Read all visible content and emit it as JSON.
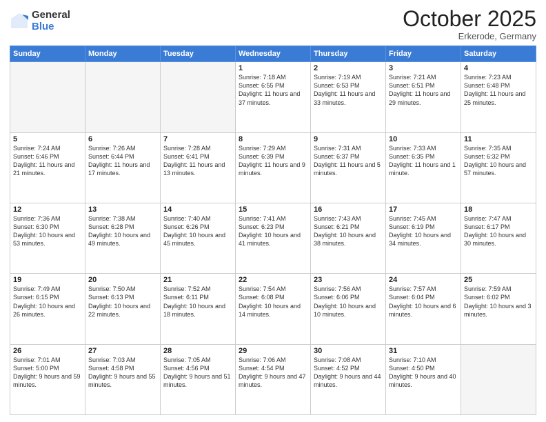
{
  "logo": {
    "general": "General",
    "blue": "Blue"
  },
  "title": "October 2025",
  "location": "Erkerode, Germany",
  "days_of_week": [
    "Sunday",
    "Monday",
    "Tuesday",
    "Wednesday",
    "Thursday",
    "Friday",
    "Saturday"
  ],
  "weeks": [
    [
      {
        "day": "",
        "info": ""
      },
      {
        "day": "",
        "info": ""
      },
      {
        "day": "",
        "info": ""
      },
      {
        "day": "1",
        "info": "Sunrise: 7:18 AM\nSunset: 6:55 PM\nDaylight: 11 hours\nand 37 minutes."
      },
      {
        "day": "2",
        "info": "Sunrise: 7:19 AM\nSunset: 6:53 PM\nDaylight: 11 hours\nand 33 minutes."
      },
      {
        "day": "3",
        "info": "Sunrise: 7:21 AM\nSunset: 6:51 PM\nDaylight: 11 hours\nand 29 minutes."
      },
      {
        "day": "4",
        "info": "Sunrise: 7:23 AM\nSunset: 6:48 PM\nDaylight: 11 hours\nand 25 minutes."
      }
    ],
    [
      {
        "day": "5",
        "info": "Sunrise: 7:24 AM\nSunset: 6:46 PM\nDaylight: 11 hours\nand 21 minutes."
      },
      {
        "day": "6",
        "info": "Sunrise: 7:26 AM\nSunset: 6:44 PM\nDaylight: 11 hours\nand 17 minutes."
      },
      {
        "day": "7",
        "info": "Sunrise: 7:28 AM\nSunset: 6:41 PM\nDaylight: 11 hours\nand 13 minutes."
      },
      {
        "day": "8",
        "info": "Sunrise: 7:29 AM\nSunset: 6:39 PM\nDaylight: 11 hours\nand 9 minutes."
      },
      {
        "day": "9",
        "info": "Sunrise: 7:31 AM\nSunset: 6:37 PM\nDaylight: 11 hours\nand 5 minutes."
      },
      {
        "day": "10",
        "info": "Sunrise: 7:33 AM\nSunset: 6:35 PM\nDaylight: 11 hours\nand 1 minute."
      },
      {
        "day": "11",
        "info": "Sunrise: 7:35 AM\nSunset: 6:32 PM\nDaylight: 10 hours\nand 57 minutes."
      }
    ],
    [
      {
        "day": "12",
        "info": "Sunrise: 7:36 AM\nSunset: 6:30 PM\nDaylight: 10 hours\nand 53 minutes."
      },
      {
        "day": "13",
        "info": "Sunrise: 7:38 AM\nSunset: 6:28 PM\nDaylight: 10 hours\nand 49 minutes."
      },
      {
        "day": "14",
        "info": "Sunrise: 7:40 AM\nSunset: 6:26 PM\nDaylight: 10 hours\nand 45 minutes."
      },
      {
        "day": "15",
        "info": "Sunrise: 7:41 AM\nSunset: 6:23 PM\nDaylight: 10 hours\nand 41 minutes."
      },
      {
        "day": "16",
        "info": "Sunrise: 7:43 AM\nSunset: 6:21 PM\nDaylight: 10 hours\nand 38 minutes."
      },
      {
        "day": "17",
        "info": "Sunrise: 7:45 AM\nSunset: 6:19 PM\nDaylight: 10 hours\nand 34 minutes."
      },
      {
        "day": "18",
        "info": "Sunrise: 7:47 AM\nSunset: 6:17 PM\nDaylight: 10 hours\nand 30 minutes."
      }
    ],
    [
      {
        "day": "19",
        "info": "Sunrise: 7:49 AM\nSunset: 6:15 PM\nDaylight: 10 hours\nand 26 minutes."
      },
      {
        "day": "20",
        "info": "Sunrise: 7:50 AM\nSunset: 6:13 PM\nDaylight: 10 hours\nand 22 minutes."
      },
      {
        "day": "21",
        "info": "Sunrise: 7:52 AM\nSunset: 6:11 PM\nDaylight: 10 hours\nand 18 minutes."
      },
      {
        "day": "22",
        "info": "Sunrise: 7:54 AM\nSunset: 6:08 PM\nDaylight: 10 hours\nand 14 minutes."
      },
      {
        "day": "23",
        "info": "Sunrise: 7:56 AM\nSunset: 6:06 PM\nDaylight: 10 hours\nand 10 minutes."
      },
      {
        "day": "24",
        "info": "Sunrise: 7:57 AM\nSunset: 6:04 PM\nDaylight: 10 hours\nand 6 minutes."
      },
      {
        "day": "25",
        "info": "Sunrise: 7:59 AM\nSunset: 6:02 PM\nDaylight: 10 hours\nand 3 minutes."
      }
    ],
    [
      {
        "day": "26",
        "info": "Sunrise: 7:01 AM\nSunset: 5:00 PM\nDaylight: 9 hours\nand 59 minutes."
      },
      {
        "day": "27",
        "info": "Sunrise: 7:03 AM\nSunset: 4:58 PM\nDaylight: 9 hours\nand 55 minutes."
      },
      {
        "day": "28",
        "info": "Sunrise: 7:05 AM\nSunset: 4:56 PM\nDaylight: 9 hours\nand 51 minutes."
      },
      {
        "day": "29",
        "info": "Sunrise: 7:06 AM\nSunset: 4:54 PM\nDaylight: 9 hours\nand 47 minutes."
      },
      {
        "day": "30",
        "info": "Sunrise: 7:08 AM\nSunset: 4:52 PM\nDaylight: 9 hours\nand 44 minutes."
      },
      {
        "day": "31",
        "info": "Sunrise: 7:10 AM\nSunset: 4:50 PM\nDaylight: 9 hours\nand 40 minutes."
      },
      {
        "day": "",
        "info": ""
      }
    ]
  ]
}
